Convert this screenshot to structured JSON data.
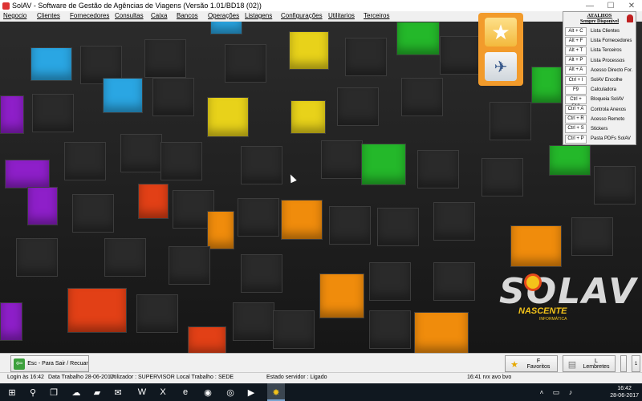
{
  "window": {
    "title": "SolAV - Software de Gestão de Agências de Viagens (Versão 1.01/BD18 (02))",
    "controls": [
      "—",
      "☐",
      "✕"
    ]
  },
  "menu": {
    "items": [
      "Negocio",
      "Clientes",
      "Fornecedores",
      "Consultas",
      "Caixa",
      "Bancos",
      "Operações",
      "Listagens",
      "Configurações",
      "Utilitarios",
      "Terceiros"
    ]
  },
  "quick_buttons": {
    "favorites_icon": "star-icon",
    "travel_icon": "airplane-icon"
  },
  "atalhos": {
    "title": "ATALHOS",
    "subtitle": "Sempre Disponivel",
    "rows": [
      {
        "key": "Alt + C",
        "label": "Lista Clientes"
      },
      {
        "key": "Alt + F",
        "label": "Lista Fornecedores"
      },
      {
        "key": "Alt + T",
        "label": "Lista Terceiros"
      },
      {
        "key": "Alt + P",
        "label": "Lista Processos"
      },
      {
        "key": "Alt + A",
        "label": "Acesso Directo For."
      },
      {
        "key": "Ctrl + I",
        "label": "SolAV Encolhe"
      },
      {
        "key": "F9",
        "label": "Calculadora"
      },
      {
        "key": "Ctrl + F10",
        "label": "Bloqueia SolAV"
      },
      {
        "key": "Ctrl + A",
        "label": "Controla Anexos"
      },
      {
        "key": "Ctrl + R",
        "label": "Acesso Remoto"
      },
      {
        "key": "Ctrl + S",
        "label": "Stickers"
      },
      {
        "key": "Ctrl + P",
        "label": "Pasta PDFs SolAV"
      }
    ]
  },
  "logo": {
    "text": "SOLAV",
    "tagline": "NASCENTE",
    "sub": "INFORMÁTICA"
  },
  "bottom": {
    "esc_label": "Esc - Para Sair / Recuar",
    "fav_key": "F",
    "fav_label": "Favoritos",
    "lem_key": "L",
    "lem_label": "Lembretes",
    "small_label": "1"
  },
  "status": {
    "login": "Login às 16:42",
    "data_trabalho": "Data Trabalho 28-06-2017",
    "utilizador": "Utilizador : SUPERVISOR",
    "local": "Local Trabalho :",
    "local_value": "SEDE",
    "estado": "Estado servidor : Ligado",
    "time": "16:41 rvx avo bvo"
  },
  "taskbar": {
    "clock": "16:42",
    "date": "28-06-2017"
  },
  "colors": {
    "accent_orange": "#f29b2b",
    "yellow": "#e8d21a",
    "blue": "#2aa6e3",
    "green": "#24b82a",
    "purple": "#8e1fc9",
    "red": "#e24016"
  }
}
